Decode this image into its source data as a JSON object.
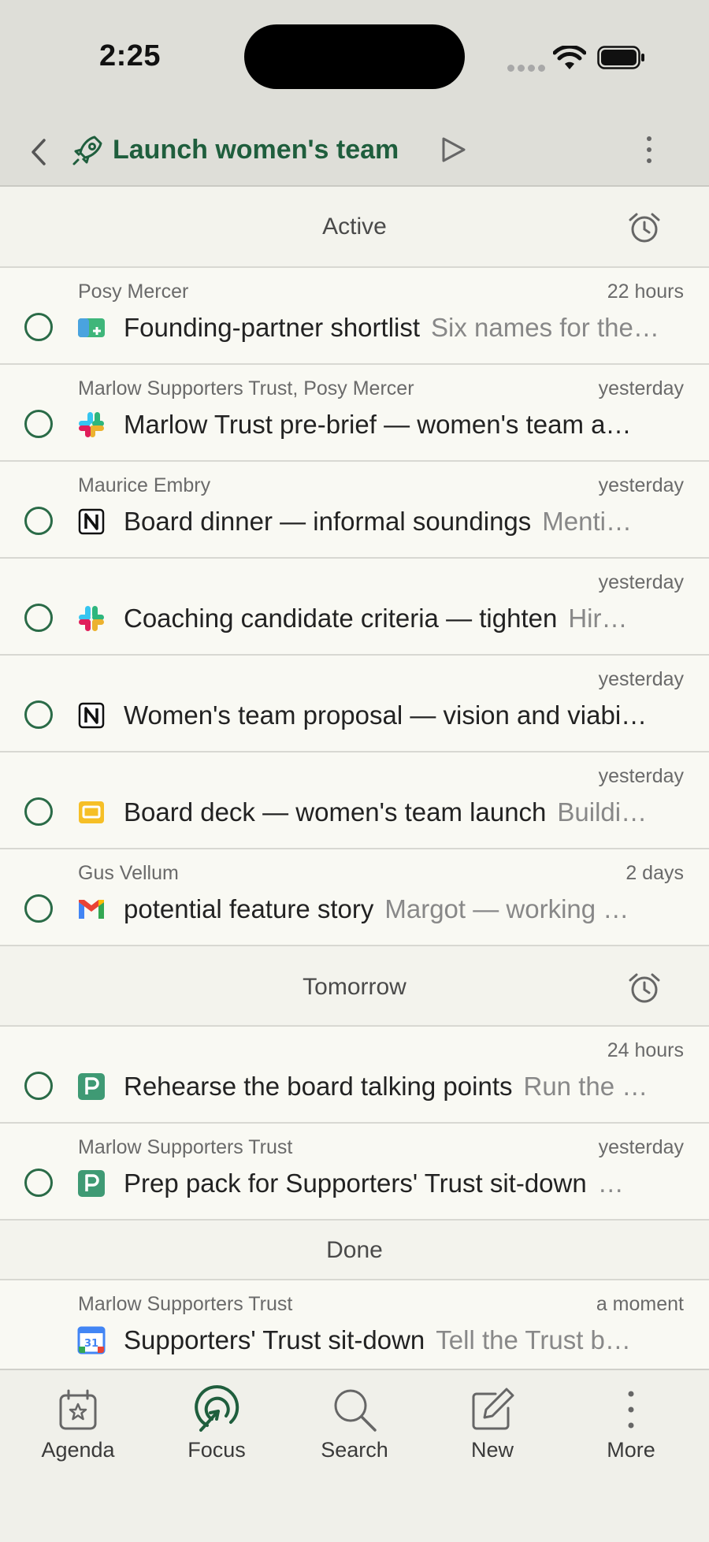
{
  "status_bar": {
    "time": "2:25"
  },
  "nav": {
    "title": "Launch women's team"
  },
  "sections": {
    "active": {
      "label": "Active",
      "rows": [
        {
          "meta_left": "Posy Mercer",
          "meta_right": "22 hours",
          "title": "Founding-partner shortlist",
          "snippet": "Six names for the…",
          "app": "board-icon"
        },
        {
          "meta_left": "Marlow Supporters Trust, Posy Mercer",
          "meta_right": "yesterday",
          "title": "Marlow Trust pre-brief — women's team a…",
          "snippet": "",
          "app": "slack-icon"
        },
        {
          "meta_left": "Maurice Embry",
          "meta_right": "yesterday",
          "title": "Board dinner — informal soundings",
          "snippet": "Menti…",
          "app": "notion-icon"
        },
        {
          "meta_left": "",
          "meta_right": "yesterday",
          "title": "Coaching candidate criteria — tighten",
          "snippet": "Hir…",
          "app": "slack-icon"
        },
        {
          "meta_left": "",
          "meta_right": "yesterday",
          "title": "Women's team proposal — vision and viabi…",
          "snippet": "",
          "app": "notion-icon"
        },
        {
          "meta_left": "",
          "meta_right": "yesterday",
          "title": "Board deck — women's team launch",
          "snippet": "Buildi…",
          "app": "slides-icon"
        },
        {
          "meta_left": "Gus Vellum",
          "meta_right": "2 days",
          "title": "potential feature story",
          "snippet": "Margot — working …",
          "app": "gmail-icon"
        }
      ]
    },
    "tomorrow": {
      "label": "Tomorrow",
      "rows": [
        {
          "meta_left": "",
          "meta_right": "24 hours",
          "title": "Rehearse the board talking points",
          "snippet": "Run the …",
          "app": "p-icon"
        },
        {
          "meta_left": "Marlow Supporters Trust",
          "meta_right": "yesterday",
          "title": "Prep pack for Supporters' Trust sit-down",
          "snippet": "…",
          "app": "p-icon"
        }
      ]
    },
    "done": {
      "label": "Done",
      "rows": [
        {
          "meta_left": "Marlow Supporters Trust",
          "meta_right": "a moment",
          "title": "Supporters' Trust sit-down",
          "snippet": "Tell the Trust b…",
          "app": "calendar-icon",
          "calendar_day": "31"
        }
      ]
    }
  },
  "tabs": [
    {
      "label": "Agenda",
      "icon": "agenda-icon"
    },
    {
      "label": "Focus",
      "icon": "focus-icon",
      "active": true
    },
    {
      "label": "Search",
      "icon": "search-icon"
    },
    {
      "label": "New",
      "icon": "compose-icon"
    },
    {
      "label": "More",
      "icon": "more-icon"
    }
  ],
  "colors": {
    "accent": "#1f5e3d",
    "check": "#2a6b47",
    "header_bg": "#deded8"
  }
}
